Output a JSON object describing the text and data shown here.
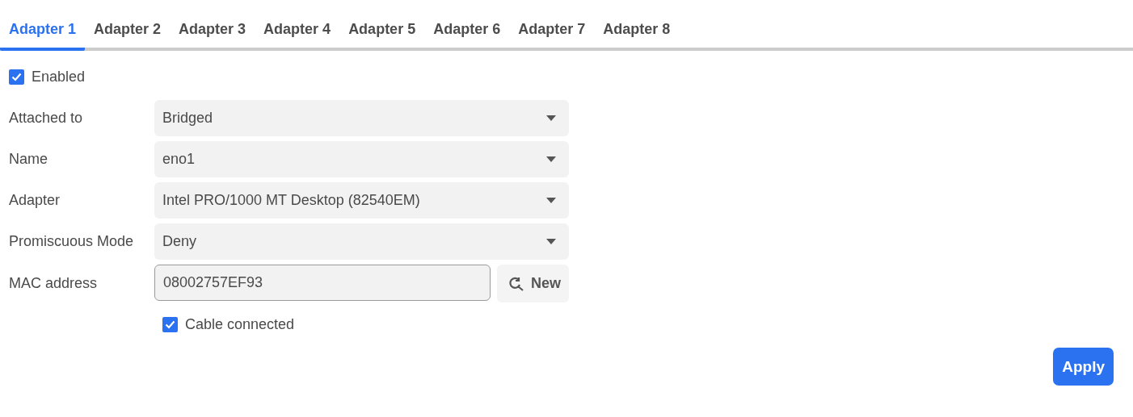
{
  "tabs": [
    {
      "label": "Adapter 1",
      "selected": true
    },
    {
      "label": "Adapter 2",
      "selected": false
    },
    {
      "label": "Adapter 3",
      "selected": false
    },
    {
      "label": "Adapter 4",
      "selected": false
    },
    {
      "label": "Adapter 5",
      "selected": false
    },
    {
      "label": "Adapter 6",
      "selected": false
    },
    {
      "label": "Adapter 7",
      "selected": false
    },
    {
      "label": "Adapter 8",
      "selected": false
    }
  ],
  "enabled": {
    "label": "Enabled",
    "checked": true
  },
  "fields": [
    {
      "kind": "select",
      "label": "Attached to",
      "value": "Bridged"
    },
    {
      "kind": "select",
      "label": "Name",
      "value": "eno1"
    },
    {
      "kind": "select",
      "label": "Adapter",
      "value": "Intel PRO/1000 MT Desktop (82540EM)"
    },
    {
      "kind": "select",
      "label": "Promiscuous Mode",
      "value": "Deny"
    },
    {
      "kind": "text",
      "label": "MAC address",
      "value": "08002757EF93",
      "button": "New"
    }
  ],
  "cable": {
    "label": "Cable connected",
    "checked": true
  },
  "apply_button": "Apply"
}
